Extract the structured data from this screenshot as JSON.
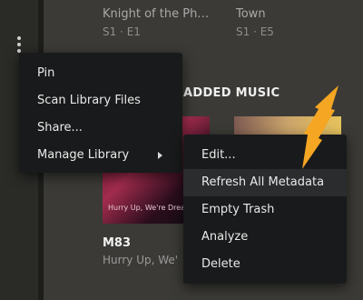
{
  "top_items": [
    {
      "title": "Knight of the Ph…",
      "subtitle": "S1 · E1"
    },
    {
      "title": "Town",
      "subtitle": "S1 · E5"
    }
  ],
  "section": {
    "heading": "ADDED MUSIC"
  },
  "album": {
    "artist": "M83",
    "title": "Hurry Up, We'",
    "cover_text": "Hurry Up, We're Dream"
  },
  "menu": {
    "items": [
      {
        "label": "Pin"
      },
      {
        "label": "Scan Library Files"
      },
      {
        "label": "Share..."
      },
      {
        "label": "Manage Library"
      }
    ]
  },
  "submenu": {
    "items": [
      {
        "label": "Edit..."
      },
      {
        "label": "Refresh All Metadata"
      },
      {
        "label": "Empty Trash"
      },
      {
        "label": "Analyze"
      },
      {
        "label": "Delete"
      }
    ]
  },
  "colors": {
    "menu_bg": "#191a1b",
    "hover_bg": "#2b2c2e",
    "arrow": "#f5a623",
    "background": "#3b3a36"
  },
  "icons": {
    "more": "kebab-icon",
    "submenu": "chevron-right-icon",
    "pointer": "orange-arrow"
  }
}
